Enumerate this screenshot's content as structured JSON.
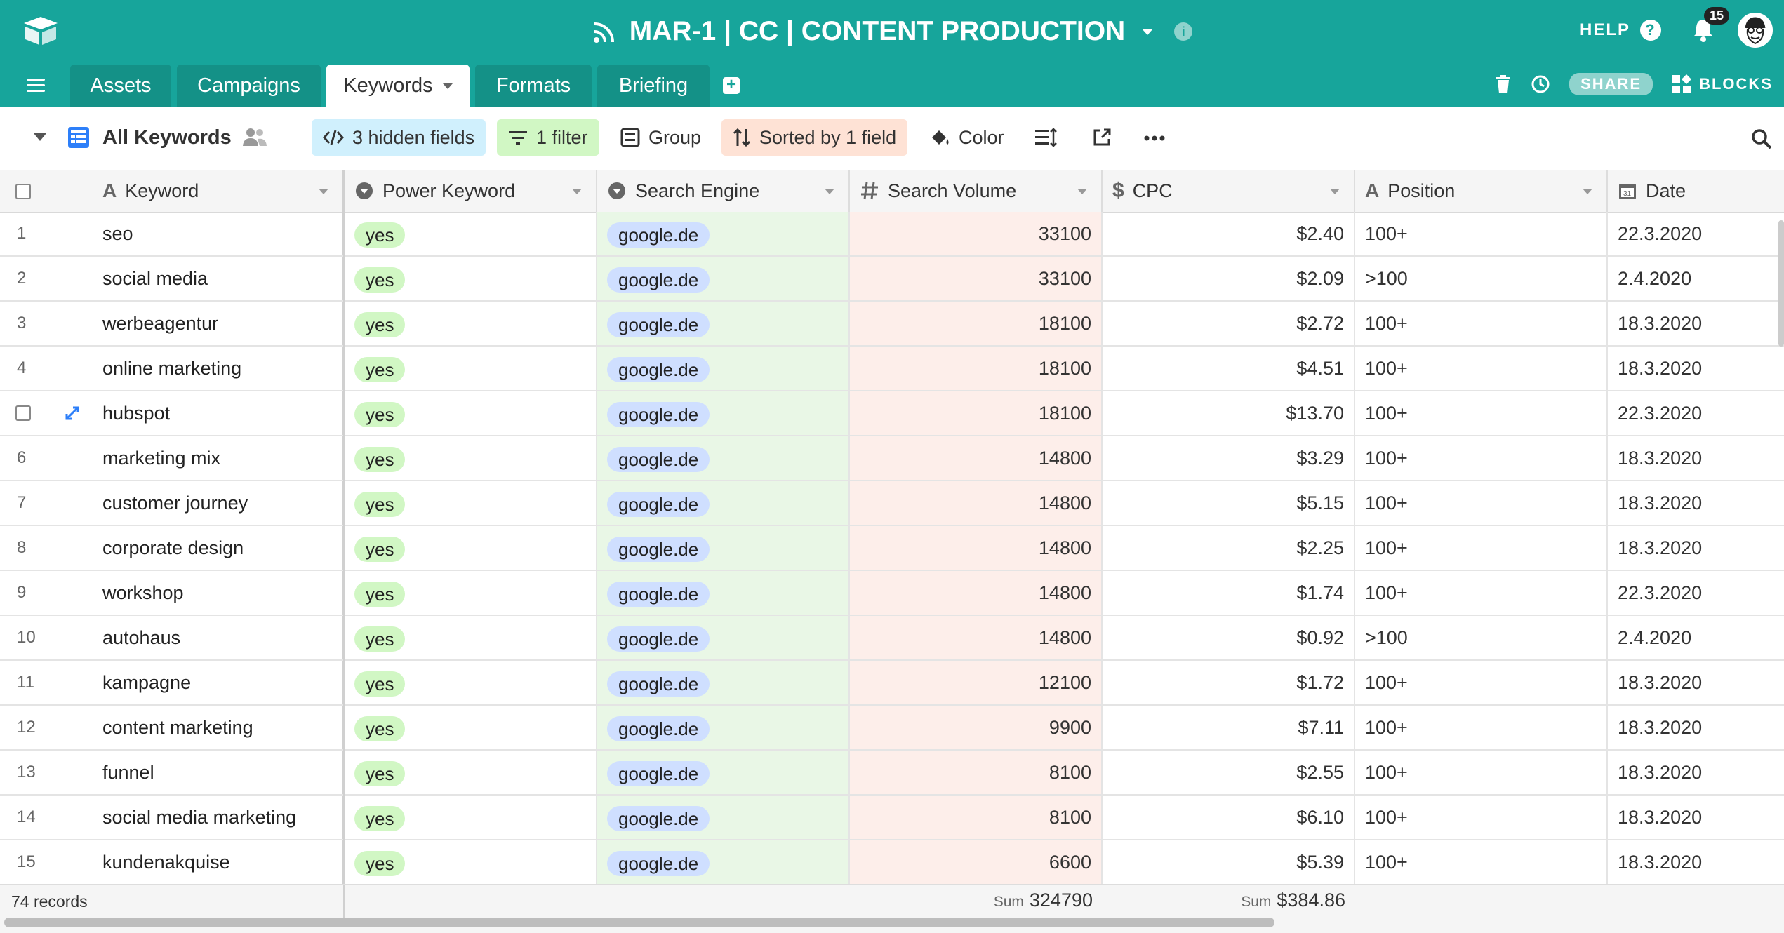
{
  "app": {
    "base_title": "MAR-1 | CC | CONTENT PRODUCTION",
    "help_label": "HELP",
    "notifications_count": "15",
    "brand_color": "#17a59b"
  },
  "tabs": [
    {
      "label": "Assets"
    },
    {
      "label": "Campaigns"
    },
    {
      "label": "Keywords"
    },
    {
      "label": "Formats"
    },
    {
      "label": "Briefing"
    }
  ],
  "toolbar_right": {
    "share_label": "SHARE",
    "blocks_label": "BLOCKS"
  },
  "viewbar": {
    "view_name": "All Keywords",
    "hidden_fields": "3 hidden fields",
    "filter": "1 filter",
    "group": "Group",
    "sorted": "Sorted by 1 field",
    "color": "Color"
  },
  "columns": {
    "keyword": "Keyword",
    "power_keyword": "Power Keyword",
    "search_engine": "Search Engine",
    "search_volume": "Search Volume",
    "cpc": "CPC",
    "position": "Position",
    "date": "Date"
  },
  "rows": [
    {
      "num": "1",
      "keyword": "seo",
      "power": "yes",
      "engine": "google.de",
      "volume": "33100",
      "cpc": "$2.40",
      "position": "100+",
      "date": "22.3.2020"
    },
    {
      "num": "2",
      "keyword": "social media",
      "power": "yes",
      "engine": "google.de",
      "volume": "33100",
      "cpc": "$2.09",
      "position": ">100",
      "date": "2.4.2020"
    },
    {
      "num": "3",
      "keyword": "werbeagentur",
      "power": "yes",
      "engine": "google.de",
      "volume": "18100",
      "cpc": "$2.72",
      "position": "100+",
      "date": "18.3.2020"
    },
    {
      "num": "4",
      "keyword": "online marketing",
      "power": "yes",
      "engine": "google.de",
      "volume": "18100",
      "cpc": "$4.51",
      "position": "100+",
      "date": "18.3.2020"
    },
    {
      "num": "",
      "keyword": "hubspot",
      "power": "yes",
      "engine": "google.de",
      "volume": "18100",
      "cpc": "$13.70",
      "position": "100+",
      "date": "22.3.2020"
    },
    {
      "num": "6",
      "keyword": "marketing mix",
      "power": "yes",
      "engine": "google.de",
      "volume": "14800",
      "cpc": "$3.29",
      "position": "100+",
      "date": "18.3.2020"
    },
    {
      "num": "7",
      "keyword": "customer journey",
      "power": "yes",
      "engine": "google.de",
      "volume": "14800",
      "cpc": "$5.15",
      "position": "100+",
      "date": "18.3.2020"
    },
    {
      "num": "8",
      "keyword": "corporate design",
      "power": "yes",
      "engine": "google.de",
      "volume": "14800",
      "cpc": "$2.25",
      "position": "100+",
      "date": "18.3.2020"
    },
    {
      "num": "9",
      "keyword": "workshop",
      "power": "yes",
      "engine": "google.de",
      "volume": "14800",
      "cpc": "$1.74",
      "position": "100+",
      "date": "22.3.2020"
    },
    {
      "num": "10",
      "keyword": "autohaus",
      "power": "yes",
      "engine": "google.de",
      "volume": "14800",
      "cpc": "$0.92",
      "position": ">100",
      "date": "2.4.2020"
    },
    {
      "num": "11",
      "keyword": "kampagne",
      "power": "yes",
      "engine": "google.de",
      "volume": "12100",
      "cpc": "$1.72",
      "position": "100+",
      "date": "18.3.2020"
    },
    {
      "num": "12",
      "keyword": "content marketing",
      "power": "yes",
      "engine": "google.de",
      "volume": "9900",
      "cpc": "$7.11",
      "position": "100+",
      "date": "18.3.2020"
    },
    {
      "num": "13",
      "keyword": "funnel",
      "power": "yes",
      "engine": "google.de",
      "volume": "8100",
      "cpc": "$2.55",
      "position": "100+",
      "date": "18.3.2020"
    },
    {
      "num": "14",
      "keyword": "social media marketing",
      "power": "yes",
      "engine": "google.de",
      "volume": "8100",
      "cpc": "$6.10",
      "position": "100+",
      "date": "18.3.2020"
    },
    {
      "num": "15",
      "keyword": "kundenakquise",
      "power": "yes",
      "engine": "google.de",
      "volume": "6600",
      "cpc": "$5.39",
      "position": "100+",
      "date": "18.3.2020"
    }
  ],
  "footer": {
    "records": "74 records",
    "sum_label": "Sum",
    "sum_volume": "324790",
    "sum_cpc": "$384.86"
  }
}
